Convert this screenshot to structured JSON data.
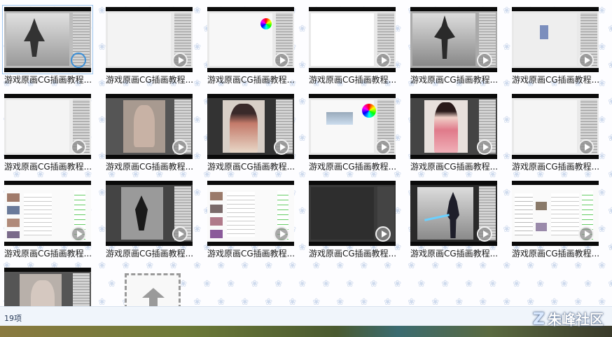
{
  "files": [
    {
      "label": "游戏原画CG插画教程..."
    },
    {
      "label": "游戏原画CG插画教程..."
    },
    {
      "label": "游戏原画CG插画教程..."
    },
    {
      "label": "游戏原画CG插画教程..."
    },
    {
      "label": "游戏原画CG插画教程..."
    },
    {
      "label": "游戏原画CG插画教程..."
    },
    {
      "label": "游戏原画CG插画教程..."
    },
    {
      "label": "游戏原画CG插画教程..."
    },
    {
      "label": "游戏原画CG插画教程..."
    },
    {
      "label": "游戏原画CG插画教程..."
    },
    {
      "label": "游戏原画CG插画教程..."
    },
    {
      "label": "游戏原画CG插画教程..."
    },
    {
      "label": "游戏原画CG插画教程..."
    },
    {
      "label": "游戏原画CG插画教程..."
    },
    {
      "label": "游戏原画CG插画教程..."
    },
    {
      "label": "游戏原画CG插画教程..."
    },
    {
      "label": "游戏原画CG插画教程..."
    },
    {
      "label": "游戏原画CG插画教程..."
    },
    {
      "label": ""
    }
  ],
  "status": {
    "item_count": "19项"
  },
  "watermark": {
    "text": "朱峰社区",
    "z": "Z"
  },
  "icons": {
    "play": "play-icon",
    "upload": "upload-arrow-icon"
  }
}
